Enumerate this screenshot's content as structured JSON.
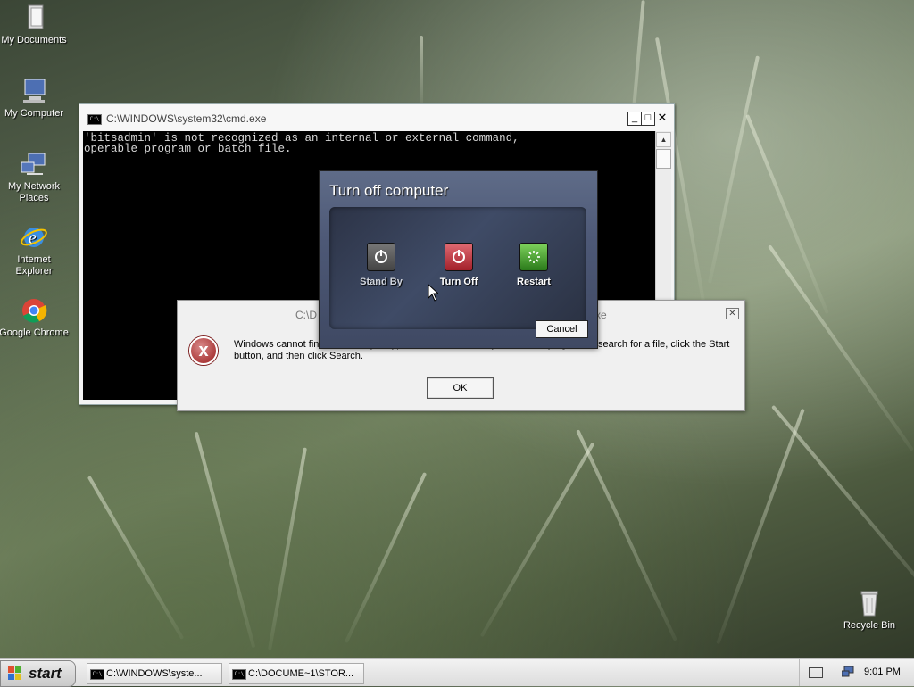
{
  "desktop": {
    "icons": [
      {
        "label": "My Documents",
        "icon": "folder-icon"
      },
      {
        "label": "My Computer",
        "icon": "computer-icon"
      },
      {
        "label": "My Network Places",
        "icon": "network-icon"
      },
      {
        "label": "Internet Explorer",
        "icon": "ie-icon"
      },
      {
        "label": "Google Chrome",
        "icon": "chrome-icon"
      },
      {
        "label": "Recycle Bin",
        "icon": "recycle-bin-icon"
      }
    ]
  },
  "cmd_window": {
    "icon_text": "C:\\",
    "title": "C:\\WINDOWS\\system32\\cmd.exe",
    "minimize": "_",
    "maximize": "□",
    "close": "✕",
    "output": "'bitsadmin' is not recognized as an internal or external command,\noperable program or batch file.",
    "scroll_up": "▲"
  },
  "error_dialog": {
    "title_left": "C:\\D",
    "title_right": "xe",
    "close": "✕",
    "icon": "x",
    "message": "Windows cannot fin                                                                        Make sure you typed the name correctly, and then try again. To search for a file, click the Start button, and then click Search.",
    "ok_label": "OK"
  },
  "turn_off_dialog": {
    "title": "Turn off computer",
    "options": [
      {
        "label": "Stand By",
        "color": "#555555"
      },
      {
        "label": "Turn Off",
        "color": "#c0303a"
      },
      {
        "label": "Restart",
        "color": "#3a9a2a"
      }
    ],
    "cancel_label": "Cancel"
  },
  "taskbar": {
    "start_label": "start",
    "tasks": [
      {
        "label": "C:\\WINDOWS\\syste..."
      },
      {
        "label": "C:\\DOCUME~1\\STOR..."
      }
    ],
    "clock": "9:01 PM"
  }
}
